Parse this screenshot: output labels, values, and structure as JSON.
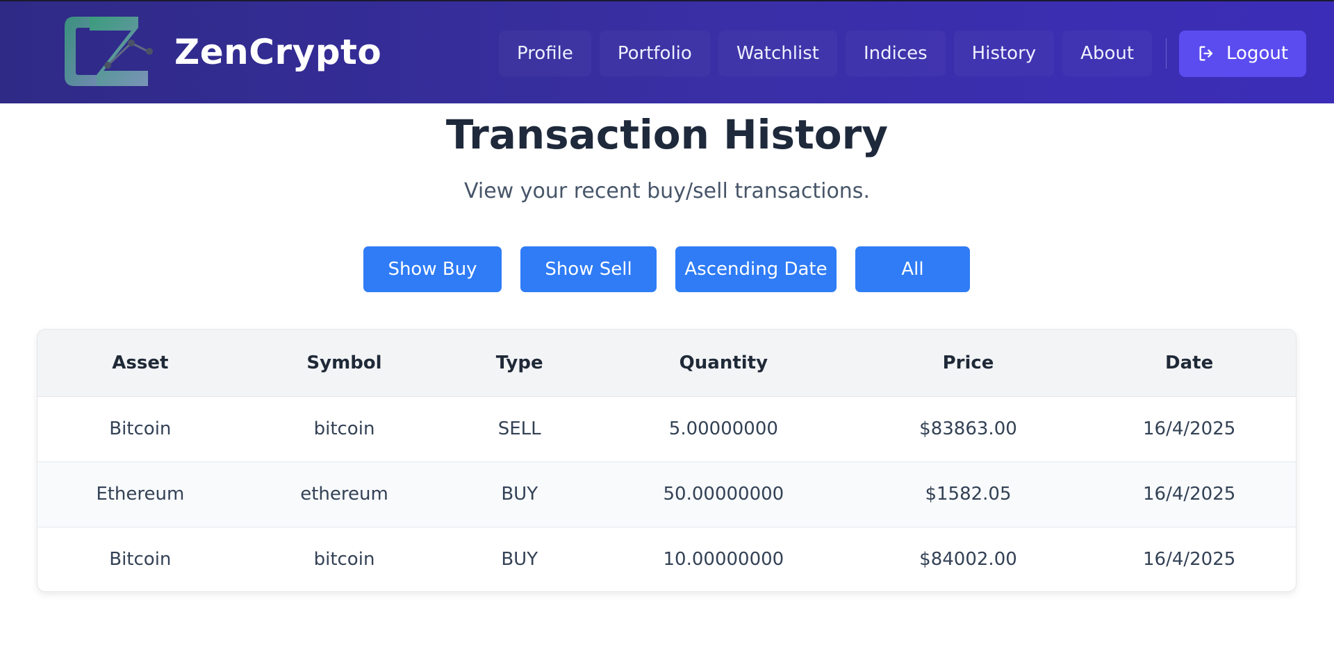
{
  "brand": {
    "name": "ZenCrypto",
    "logo_icon": "zencrypto-logo",
    "colors": {
      "logo_start": "#3b9c7c",
      "logo_end": "#7a93b8"
    }
  },
  "nav": {
    "items": [
      {
        "label": "Profile"
      },
      {
        "label": "Portfolio"
      },
      {
        "label": "Watchlist"
      },
      {
        "label": "Indices"
      },
      {
        "label": "History"
      },
      {
        "label": "About"
      }
    ],
    "logout_label": "Logout",
    "logout_icon": "logout-icon"
  },
  "page": {
    "title": "Transaction History",
    "subtitle": "View your recent buy/sell transactions."
  },
  "filters": {
    "show_buy": "Show Buy",
    "show_sell": "Show Sell",
    "ascending_date": "Ascending Date",
    "all": "All"
  },
  "table": {
    "headers": [
      "Asset",
      "Symbol",
      "Type",
      "Quantity",
      "Price",
      "Date"
    ],
    "rows": [
      [
        "Bitcoin",
        "bitcoin",
        "SELL",
        "5.00000000",
        "$83863.00",
        "16/4/2025"
      ],
      [
        "Ethereum",
        "ethereum",
        "BUY",
        "50.00000000",
        "$1582.05",
        "16/4/2025"
      ],
      [
        "Bitcoin",
        "bitcoin",
        "BUY",
        "10.00000000",
        "$84002.00",
        "16/4/2025"
      ]
    ]
  },
  "colors": {
    "header_bg_start": "#2f2a86",
    "header_bg_end": "#3c2db8",
    "accent_button": "#2f7cf6",
    "logout_button": "#5b4cf0"
  }
}
